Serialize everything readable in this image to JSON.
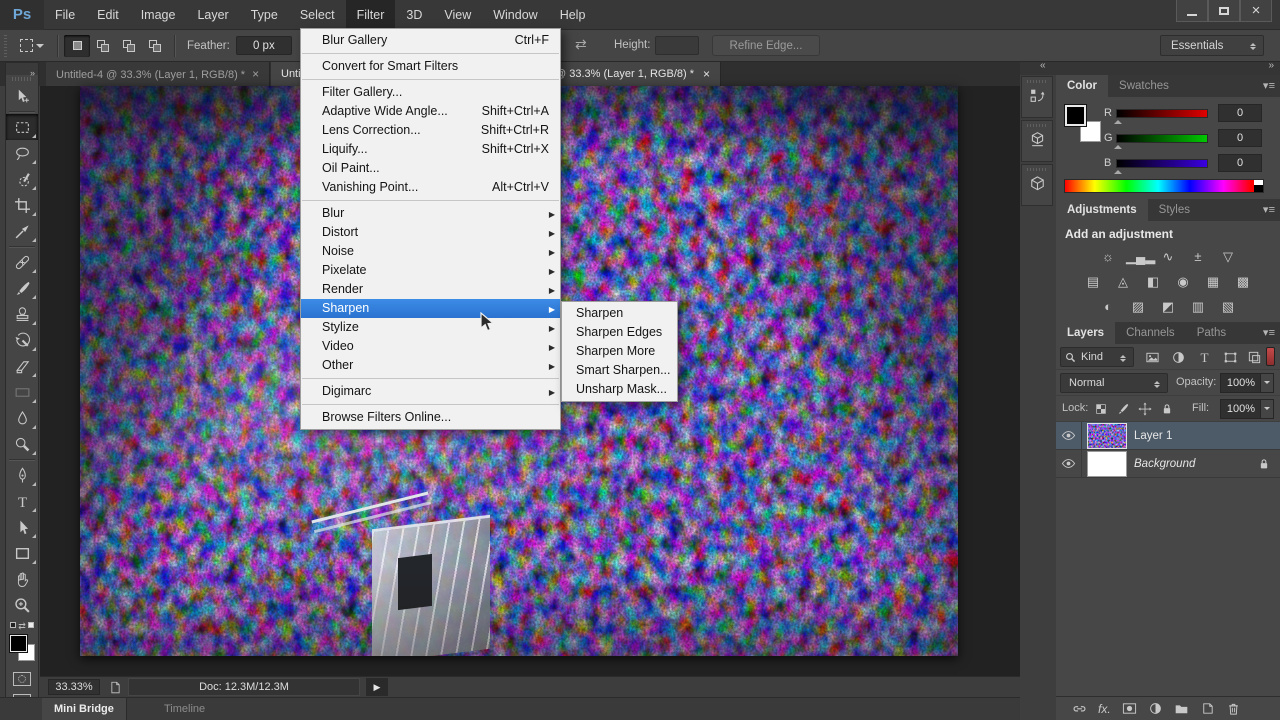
{
  "window": {
    "logo": "Ps"
  },
  "menubar": {
    "items": [
      "File",
      "Edit",
      "Image",
      "Layer",
      "Type",
      "Select",
      "Filter",
      "3D",
      "View",
      "Window",
      "Help"
    ],
    "active": "Filter"
  },
  "options_bar": {
    "feather_label": "Feather:",
    "feather_value": "0 px",
    "height_label": "Height:",
    "height_value": "",
    "refine_edge_label": "Refine Edge...",
    "workspace": "Essentials"
  },
  "document_tabs": {
    "tab1_title": "Untitled-4 @ 33.3% (Layer 1, RGB/8) *",
    "tab2_title_left": "Unti",
    "tab2_title_right": "@ 33.3% (Layer 1, RGB/8) *"
  },
  "filter_menu": {
    "items": [
      {
        "label": "Blur Gallery",
        "shortcut": "Ctrl+F"
      },
      {
        "label": "Convert for Smart Filters",
        "shortcut": ""
      },
      {
        "label": "Filter Gallery...",
        "shortcut": ""
      },
      {
        "label": "Adaptive Wide Angle...",
        "shortcut": "Shift+Ctrl+A"
      },
      {
        "label": "Lens Correction...",
        "shortcut": "Shift+Ctrl+R"
      },
      {
        "label": "Liquify...",
        "shortcut": "Shift+Ctrl+X"
      },
      {
        "label": "Oil Paint...",
        "shortcut": ""
      },
      {
        "label": "Vanishing Point...",
        "shortcut": "Alt+Ctrl+V"
      },
      {
        "label": "Blur"
      },
      {
        "label": "Distort"
      },
      {
        "label": "Noise"
      },
      {
        "label": "Pixelate"
      },
      {
        "label": "Render"
      },
      {
        "label": "Sharpen",
        "highlighted": true
      },
      {
        "label": "Stylize"
      },
      {
        "label": "Video"
      },
      {
        "label": "Other"
      },
      {
        "label": "Digimarc"
      },
      {
        "label": "Browse Filters Online...",
        "shortcut": ""
      }
    ]
  },
  "sharpen_submenu": {
    "items": [
      "Sharpen",
      "Sharpen Edges",
      "Sharpen More",
      "Smart Sharpen...",
      "Unsharp Mask..."
    ]
  },
  "toolbar": {
    "tools": [
      "move",
      "rectangular-marquee",
      "lasso",
      "quick-selection",
      "crop",
      "eyedropper",
      "spot-healing-brush",
      "brush",
      "clone-stamp",
      "history-brush",
      "eraser",
      "gradient",
      "blur",
      "dodge",
      "pen",
      "horizontal-type",
      "path-selection",
      "rectangle",
      "hand",
      "zoom"
    ],
    "active_tool": "rectangular-marquee"
  },
  "color_panel": {
    "tabs": [
      "Color",
      "Swatches"
    ],
    "active_tab": "Color",
    "channels": [
      {
        "label": "R",
        "value": "0"
      },
      {
        "label": "G",
        "value": "0"
      },
      {
        "label": "B",
        "value": "0"
      }
    ]
  },
  "adjustments_panel": {
    "tabs": [
      "Adjustments",
      "Styles"
    ],
    "active_tab": "Adjustments",
    "heading": "Add an adjustment",
    "icons": [
      {
        "name": "brightness-contrast",
        "glyph": "☼"
      },
      {
        "name": "levels",
        "glyph": "▁▄▂"
      },
      {
        "name": "curves",
        "glyph": "∿"
      },
      {
        "name": "exposure",
        "glyph": "±"
      },
      {
        "name": "vibrance",
        "glyph": "▽"
      },
      {
        "name": "hue-saturation",
        "glyph": "▤"
      },
      {
        "name": "color-balance",
        "glyph": "◬"
      },
      {
        "name": "black-white",
        "glyph": "◧"
      },
      {
        "name": "photo-filter",
        "glyph": "◉"
      },
      {
        "name": "channel-mixer",
        "glyph": "▦"
      },
      {
        "name": "color-lookup",
        "glyph": "▩"
      },
      {
        "name": "invert",
        "glyph": "◐"
      },
      {
        "name": "posterize",
        "glyph": "▨"
      },
      {
        "name": "threshold",
        "glyph": "◩"
      },
      {
        "name": "gradient-map",
        "glyph": "▥"
      },
      {
        "name": "selective-color",
        "glyph": "▧"
      }
    ]
  },
  "layers_panel": {
    "tabs": [
      "Layers",
      "Channels",
      "Paths"
    ],
    "active_tab": "Layers",
    "kind_filter": "Kind",
    "blend_mode": "Normal",
    "opacity_label": "Opacity:",
    "opacity_value": "100%",
    "lock_label": "Lock:",
    "fill_label": "Fill:",
    "fill_value": "100%",
    "fx_label": "fx.",
    "layers": [
      {
        "name": "Layer 1",
        "selected": true
      },
      {
        "name": "Background",
        "locked": true
      }
    ]
  },
  "status_bar": {
    "zoom_value": "33.33%",
    "doc_info": "Doc: 12.3M/12.3M"
  },
  "bottom_tabs": [
    {
      "label": "Mini Bridge",
      "active": true
    },
    {
      "label": "Timeline",
      "active": false
    }
  ],
  "colors": {
    "menu_highlight": "#2f7fe0",
    "selected_layer_row": "#4d5a68",
    "filter_toggle_red": "#b53a3a",
    "ui_background": "#3e3e3e"
  }
}
